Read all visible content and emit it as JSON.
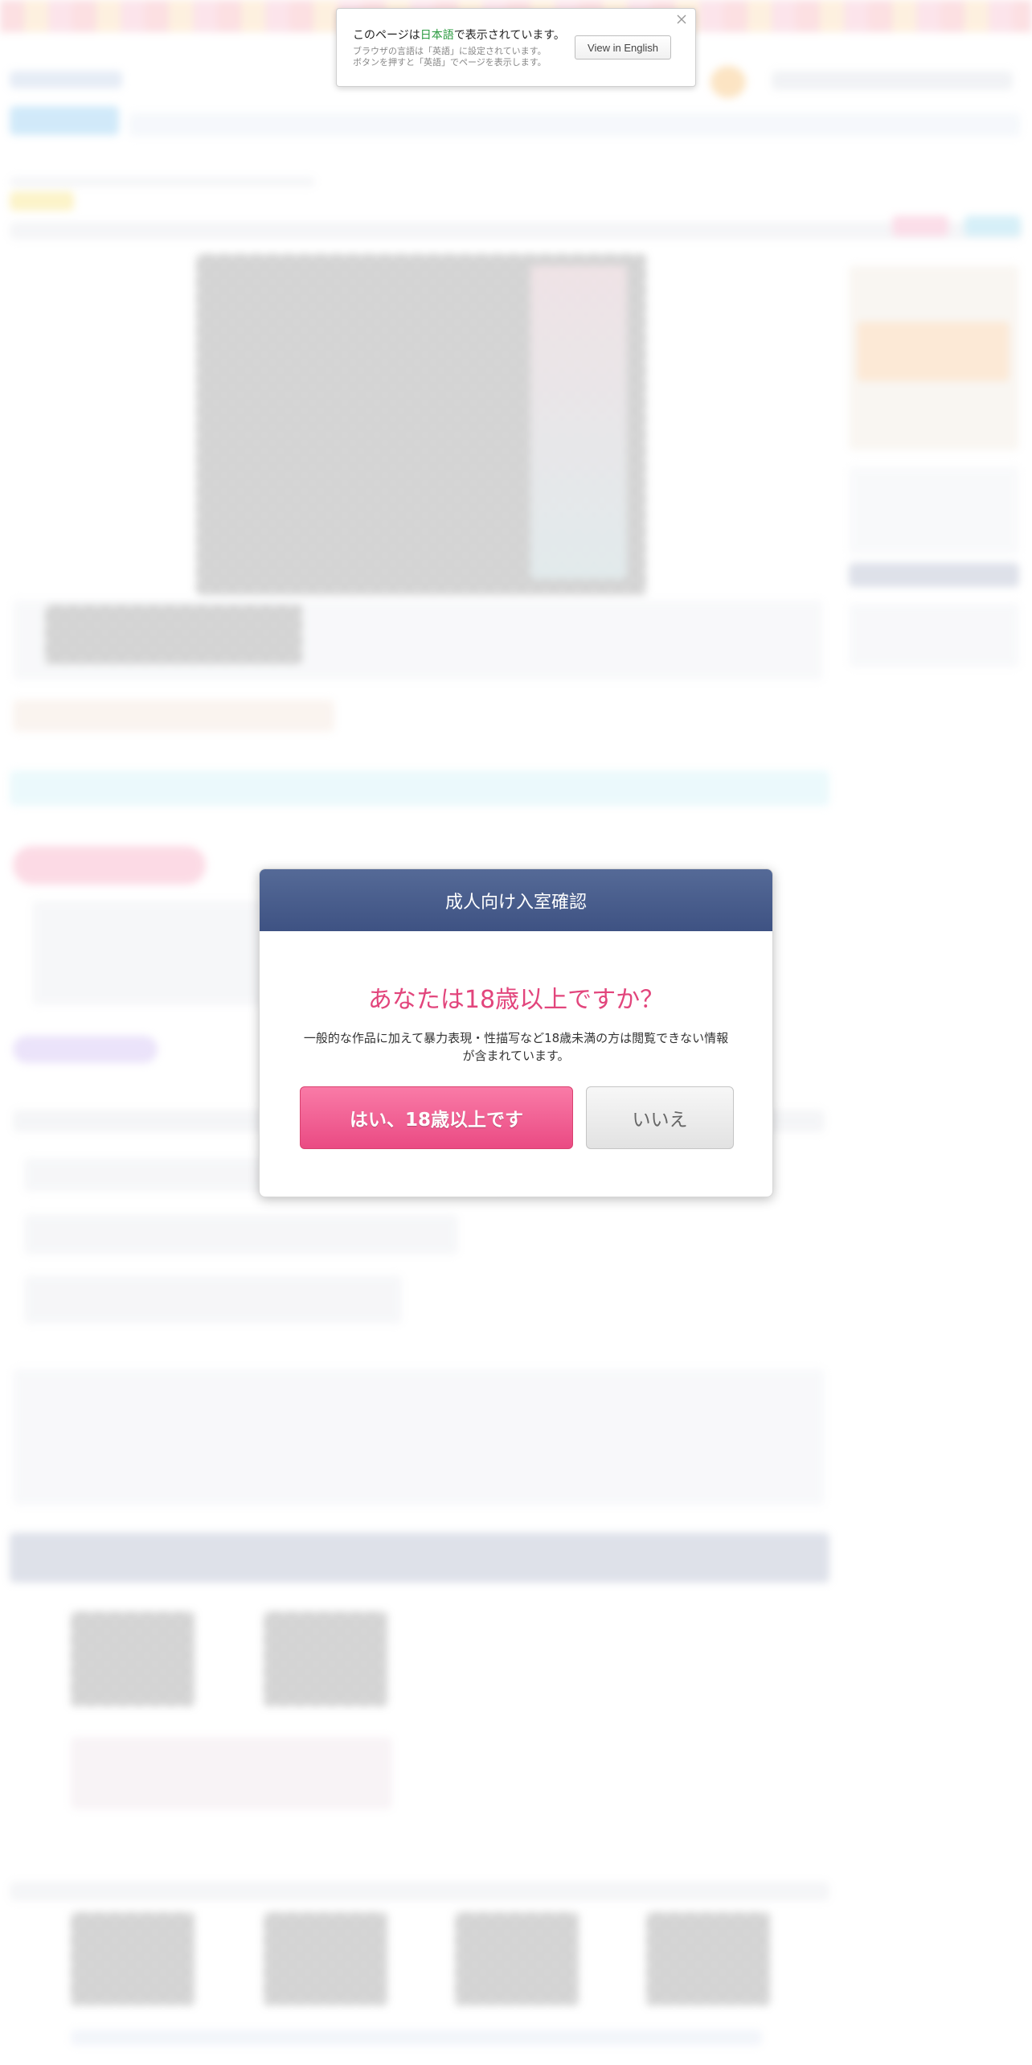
{
  "language_notice": {
    "message_prefix": "このページは",
    "message_language": "日本語",
    "message_suffix": "で表示されています。",
    "sub_line1": "ブラウザの言語は「英語」に設定されています。",
    "sub_line2": "ボタンを押すと「英語」でページを表示します。",
    "view_in_english_label": "View in English",
    "close_icon": "close-icon"
  },
  "age_modal": {
    "title": "成人向け入室確認",
    "question": "あなたは18歳以上ですか？",
    "note": "一般的な作品に加えて暴力表現・性描写など18歳未満の方は閲覧できない情報が含まれています。",
    "yes_label": "はい、18歳以上です",
    "no_label": "いいえ"
  },
  "colors": {
    "modal_header": "#4a5e8e",
    "question_pink": "#e2457c",
    "yes_button": "#f06292",
    "language_highlight": "#2a9a3f"
  }
}
